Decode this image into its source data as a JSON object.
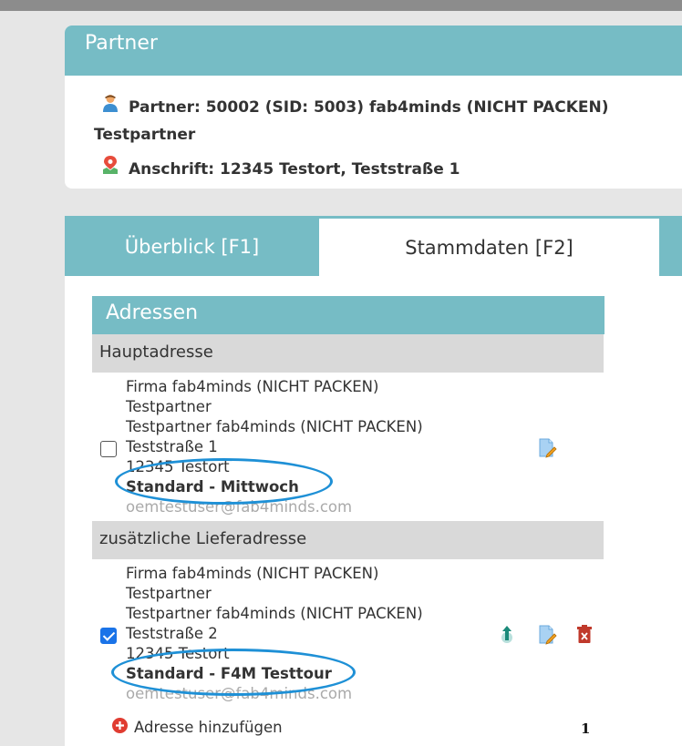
{
  "partner": {
    "title": "Partner",
    "partner_line": "Partner: 50002 (SID: 5003) fab4minds (NICHT PACKEN)",
    "partner_line2": "Testpartner",
    "address_line": "Anschrift: 12345 Testort, Teststraße 1"
  },
  "tabs": [
    {
      "label": "Überblick [F1]"
    },
    {
      "label": "Stammdaten [F2]"
    }
  ],
  "addresses": {
    "title": "Adressen",
    "main": {
      "header": "Hauptadresse",
      "lines": [
        "Firma fab4minds (NICHT PACKEN)",
        "Testpartner",
        "Testpartner fab4minds (NICHT PACKEN)",
        "Teststraße 1",
        "12345 Testort"
      ],
      "bold": "Standard - Mittwoch",
      "email": "oemtestuser@fab4minds.com",
      "checked": false
    },
    "delivery": {
      "header": "zusätzliche Lieferadresse",
      "lines": [
        "Firma fab4minds (NICHT PACKEN)",
        "Testpartner",
        "Testpartner fab4minds (NICHT PACKEN)",
        "Teststraße 2",
        "12345 Testort"
      ],
      "bold": "Standard - F4M Testtour",
      "email": "oemtestuser@fab4minds.com",
      "checked": true
    },
    "add_label": "Adresse hinzufügen",
    "count": "1"
  },
  "colors": {
    "accent": "#76bcc5",
    "section_bg": "#d9d9d9",
    "highlight_oval": "#1e90d6",
    "checkbox": "#1a73e8",
    "delete": "#c0392b"
  },
  "icons": {
    "partner": "person-icon",
    "address": "map-pin-icon",
    "edit": "edit-document-icon",
    "set_main": "arrow-up-icon",
    "delete": "trash-icon",
    "add": "plus-circle-icon"
  }
}
